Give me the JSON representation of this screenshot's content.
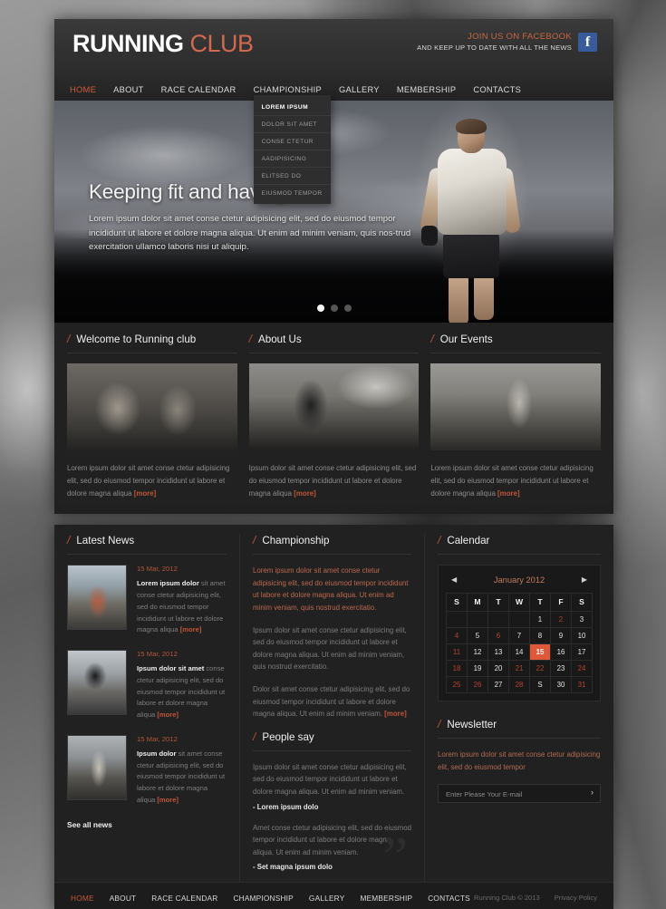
{
  "header": {
    "logo_primary": "RUNNING",
    "logo_secondary": " CLUB",
    "facebook_line1": "JOIN US ON FACEBOOK",
    "facebook_line2": "AND KEEP UP TO DATE WITH ALL THE NEWS",
    "facebook_icon": "f"
  },
  "nav": {
    "items": [
      {
        "label": "HOME",
        "active": true
      },
      {
        "label": "ABOUT",
        "active": false
      },
      {
        "label": "RACE CALENDAR",
        "active": false
      },
      {
        "label": "CHAMPIONSHIP",
        "active": false
      },
      {
        "label": "GALLERY",
        "active": false
      },
      {
        "label": "MEMBERSHIP",
        "active": false
      },
      {
        "label": "CONTACTS",
        "active": false
      }
    ],
    "dropdown": [
      "LOREM IPSUM",
      "DOLOR SIT AMET",
      "CONSE CTETUR",
      "AADIPISICING",
      "ELITSED DO",
      "EIUSMOD TEMPOR"
    ]
  },
  "hero": {
    "title": "Keeping fit and having fun",
    "description": "Lorem ipsum dolor sit amet conse ctetur adipisicing elit, sed do eiusmod tempor incididunt ut labore et dolore magna aliqua. Ut enim ad minim veniam, quis nos-trud exercitation ullamco laboris nisi ut aliquip.",
    "slider_dots": 3,
    "active_dot": 0
  },
  "features": [
    {
      "title": "Welcome to Running club",
      "text": "Lorem ipsum dolor sit amet conse ctetur adipisicing elit, sed do eiusmod tempor incididunt ut labore et dolore magna aliqua ",
      "more": "[more]"
    },
    {
      "title": "About Us",
      "text": "Ipsum dolor sit amet conse ctetur adipisicing elit, sed do eiusmod tempor incididunt ut labore et dolore magna aliqua ",
      "more": "[more]"
    },
    {
      "title": "Our Events",
      "text": "Lorem ipsum dolor sit amet conse ctetur adipisicing elit, sed do eiusmod tempor incididunt ut labore et dolore magna aliqua ",
      "more": "[more]"
    }
  ],
  "news": {
    "title": "Latest News",
    "items": [
      {
        "date": "15 Mar, 2012",
        "bold": "Lorem ipsum dolor",
        "text": " sit amet conse ctetur adipisicing elit, sed do eiusmod tempor incididunt ut labore et dolore magna aliqua ",
        "more": "[more]"
      },
      {
        "date": "15 Mar, 2012",
        "bold": "Ipsum dolor sit amet",
        "text": " conse ctetur adipisicing elit, sed do eiusmod tempor incididunt ut labore et dolore magna aliqua ",
        "more": "[more]"
      },
      {
        "date": "15 Mar, 2012",
        "bold": "Ipsum dolor",
        "text": " sit amet conse ctetur adipisicing elit, sed do eiusmod tempor incididunt ut labore et dolore magna aliqua ",
        "more": "[more]"
      }
    ],
    "see_all": "See all news"
  },
  "championship": {
    "title": "Championship",
    "para1": "Lorem ipsum dolor sit amet conse ctetur adipisicing elit, sed do eiusmod tempor incididunt ut labore et dolore magna aliqua. Ut enim ad minim veniam, quis nostrud exercitatio.",
    "para2": "Ipsum dolor sit amet conse ctetur adipisicing elit, sed do eiusmod tempor incididunt ut labore et dolore magna aliqua. Ut enim ad minim veniam, quis nostrud exercitatio.",
    "para3": "Dolor sit amet conse ctetur adipisicing elit, sed do eiusmod tempor incididunt ut labore et dolore magna aliqua. Ut enim ad minim veniam. ",
    "more": "[more]"
  },
  "people_say": {
    "title": "People say",
    "quotes": [
      {
        "text": "Ipsum dolor sit amet conse ctetur adipisicing elit, sed do eiusmod tempor incididunt ut labore et dolore magna aliqua. Ut enim ad minim veniam.",
        "author": "- Lorem ipsum dolo"
      },
      {
        "text": "Amet conse ctetur adipisicing elit, sed do eiusmod tempor incididunt ut labore et dolore magna aliqua. Ut enim ad minim veniam.",
        "author": "- Set magna ipsum dolo"
      }
    ],
    "quote_mark": "”"
  },
  "calendar": {
    "title": "Calendar",
    "month": "January 2012",
    "prev_icon": "◀",
    "next_icon": "▶",
    "weekdays": [
      "S",
      "M",
      "T",
      "W",
      "T",
      "F",
      "S"
    ],
    "selected_day": 15,
    "weeks": [
      [
        {
          "d": "",
          "style": "empty"
        },
        {
          "d": "",
          "style": "empty"
        },
        {
          "d": "",
          "style": "empty"
        },
        {
          "d": "",
          "style": "empty"
        },
        {
          "d": "1",
          "style": "white"
        },
        {
          "d": "2",
          "style": "red"
        },
        {
          "d": "3",
          "style": "white"
        }
      ],
      [
        {
          "d": "4",
          "style": "red"
        },
        {
          "d": "5",
          "style": "white"
        },
        {
          "d": "6",
          "style": "red"
        },
        {
          "d": "7",
          "style": "white"
        },
        {
          "d": "8",
          "style": "white"
        },
        {
          "d": "9",
          "style": "white"
        },
        {
          "d": "10",
          "style": "white"
        }
      ],
      [
        {
          "d": "11",
          "style": "red"
        },
        {
          "d": "12",
          "style": "white"
        },
        {
          "d": "13",
          "style": "white"
        },
        {
          "d": "14",
          "style": "white"
        },
        {
          "d": "15",
          "style": "sel"
        },
        {
          "d": "16",
          "style": "white"
        },
        {
          "d": "17",
          "style": "white"
        }
      ],
      [
        {
          "d": "18",
          "style": "red"
        },
        {
          "d": "19",
          "style": "white"
        },
        {
          "d": "20",
          "style": "white"
        },
        {
          "d": "21",
          "style": "red"
        },
        {
          "d": "22",
          "style": "red"
        },
        {
          "d": "23",
          "style": "white"
        },
        {
          "d": "24",
          "style": "red"
        }
      ],
      [
        {
          "d": "25",
          "style": "red"
        },
        {
          "d": "26",
          "style": "red"
        },
        {
          "d": "27",
          "style": "white"
        },
        {
          "d": "28",
          "style": "red"
        },
        {
          "d": "S",
          "style": "white"
        },
        {
          "d": "30",
          "style": "white"
        },
        {
          "d": "31",
          "style": "red"
        }
      ]
    ]
  },
  "newsletter": {
    "title": "Newsletter",
    "text": "Lorem ipsum dolor sit amet conse ctetur adipisicing elit, sed do eiusmod tempor",
    "placeholder": "Enter Please Your E-mail",
    "submit_icon": "›"
  },
  "footer": {
    "nav": [
      {
        "label": "HOME",
        "active": true
      },
      {
        "label": "ABOUT",
        "active": false
      },
      {
        "label": "RACE CALENDAR",
        "active": false
      },
      {
        "label": "CHAMPIONSHIP",
        "active": false
      },
      {
        "label": "GALLERY",
        "active": false
      },
      {
        "label": "MEMBERSHIP",
        "active": false
      },
      {
        "label": "CONTACTS",
        "active": false
      }
    ],
    "copyright": "Running Club © 2013",
    "privacy": "Privacy Policy"
  },
  "colors": {
    "accent": "#c4563a",
    "selected_day": "#e0583a",
    "facebook_blue": "#3a5b9b",
    "panel_bg": "#212121"
  }
}
